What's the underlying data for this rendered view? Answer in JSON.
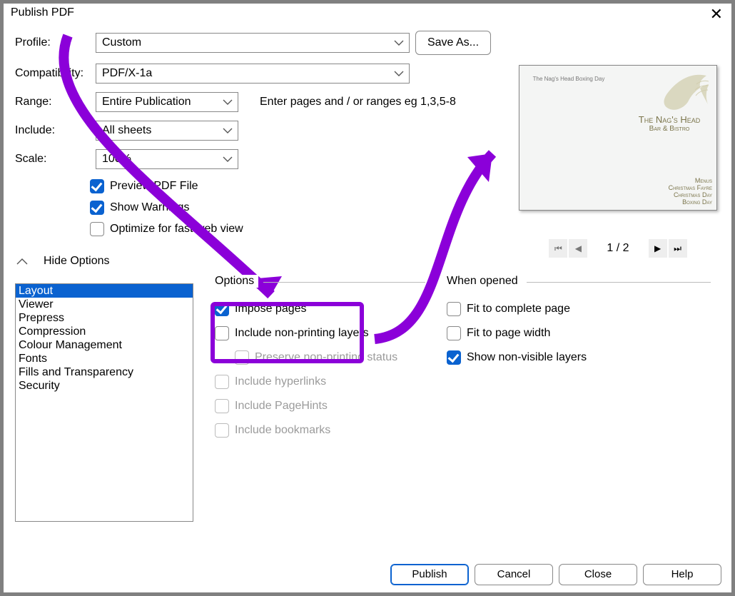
{
  "title": "Publish PDF",
  "labels": {
    "profile": "Profile:",
    "compatibility": "Compatibility:",
    "range": "Range:",
    "include": "Include:",
    "scale": "Scale:",
    "range_hint": "Enter pages and / or ranges eg 1,3,5-8",
    "hide_options": "Hide Options"
  },
  "values": {
    "profile": "Custom",
    "compatibility": "PDF/X-1a",
    "range": "Entire Publication",
    "include": "All sheets",
    "scale": "100%"
  },
  "buttons": {
    "save_as": "Save As...",
    "publish": "Publish",
    "cancel": "Cancel",
    "close": "Close",
    "help": "Help"
  },
  "top_checks": {
    "preview": "Preview PDF File",
    "warnings": "Show Warnings",
    "optimize": "Optimize for fast web view"
  },
  "categories": [
    "Layout",
    "Viewer",
    "Prepress",
    "Compression",
    "Colour Management",
    "Fonts",
    "Fills and Transparency",
    "Security"
  ],
  "options_group": {
    "legend": "Options",
    "impose": "Impose pages",
    "nonprint": "Include non-printing layers",
    "preserve": "Preserve non-printing status",
    "hyperlinks": "Include hyperlinks",
    "pagehints": "Include PageHints",
    "bookmarks": "Include bookmarks"
  },
  "when_opened": {
    "legend": "When opened",
    "fit_page": "Fit to complete page",
    "fit_width": "Fit to page width",
    "show_nonvis": "Show non-visible layers"
  },
  "preview": {
    "top_caption": "The Nag's Head Boxing Day",
    "title_line1": "The Nag's Head",
    "title_line2": "Bar & Bistro",
    "menus": [
      "Menus",
      "Christmas Fayre",
      "Christmas Day",
      "Boxing Day"
    ]
  },
  "pager": {
    "current": "1 / 2"
  }
}
